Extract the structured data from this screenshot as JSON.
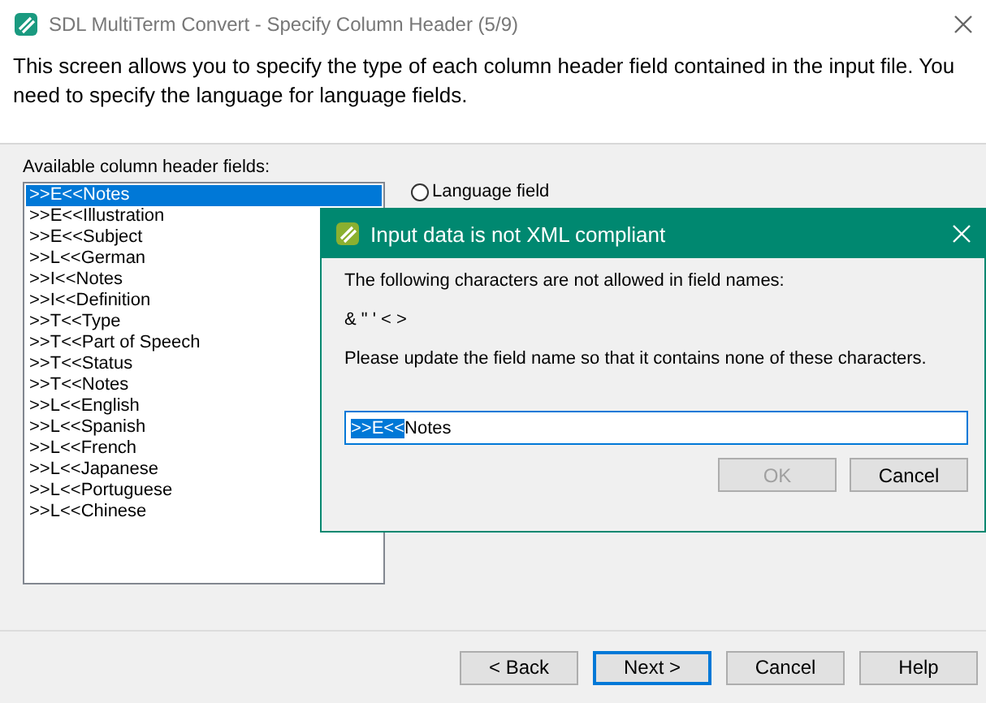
{
  "window": {
    "title": "SDL MultiTerm Convert - Specify Column Header (5/9)"
  },
  "intro": "This screen allows you to specify the type of each column header field contained in the input file. You need to specify the language for language fields.",
  "fields_label": "Available column header fields:",
  "fields": [
    {
      "label": ">>E<<Notes",
      "selected": true
    },
    {
      "label": ">>E<<Illustration",
      "selected": false
    },
    {
      "label": ">>E<<Subject",
      "selected": false
    },
    {
      "label": ">>L<<German",
      "selected": false
    },
    {
      "label": ">>I<<Notes",
      "selected": false
    },
    {
      "label": ">>I<<Definition",
      "selected": false
    },
    {
      "label": ">>T<<Type",
      "selected": false
    },
    {
      "label": ">>T<<Part of Speech",
      "selected": false
    },
    {
      "label": ">>T<<Status",
      "selected": false
    },
    {
      "label": ">>T<<Notes",
      "selected": false
    },
    {
      "label": ">>L<<English",
      "selected": false
    },
    {
      "label": ">>L<<Spanish",
      "selected": false
    },
    {
      "label": ">>L<<French",
      "selected": false
    },
    {
      "label": ">>L<<Japanese",
      "selected": false
    },
    {
      "label": ">>L<<Portuguese",
      "selected": false
    },
    {
      "label": ">>L<<Chinese",
      "selected": false
    }
  ],
  "field_type": {
    "label": "Language field",
    "selected": false
  },
  "dialog": {
    "title": "Input data is not XML compliant",
    "message": "The following characters are not allowed in field names:",
    "characters": "& \" ' < >",
    "instruction": "Please update the field name so that it contains none of these characters.",
    "input": {
      "value_selected": ">>E<<",
      "value_rest": "Notes"
    },
    "buttons": [
      {
        "label": "OK",
        "disabled": true
      },
      {
        "label": "Cancel",
        "disabled": false
      }
    ]
  },
  "buttons": [
    {
      "label": "< Back",
      "default": false
    },
    {
      "label": "Next >",
      "default": true
    },
    {
      "label": "Cancel",
      "default": false
    },
    {
      "label": "Help",
      "default": false
    }
  ]
}
